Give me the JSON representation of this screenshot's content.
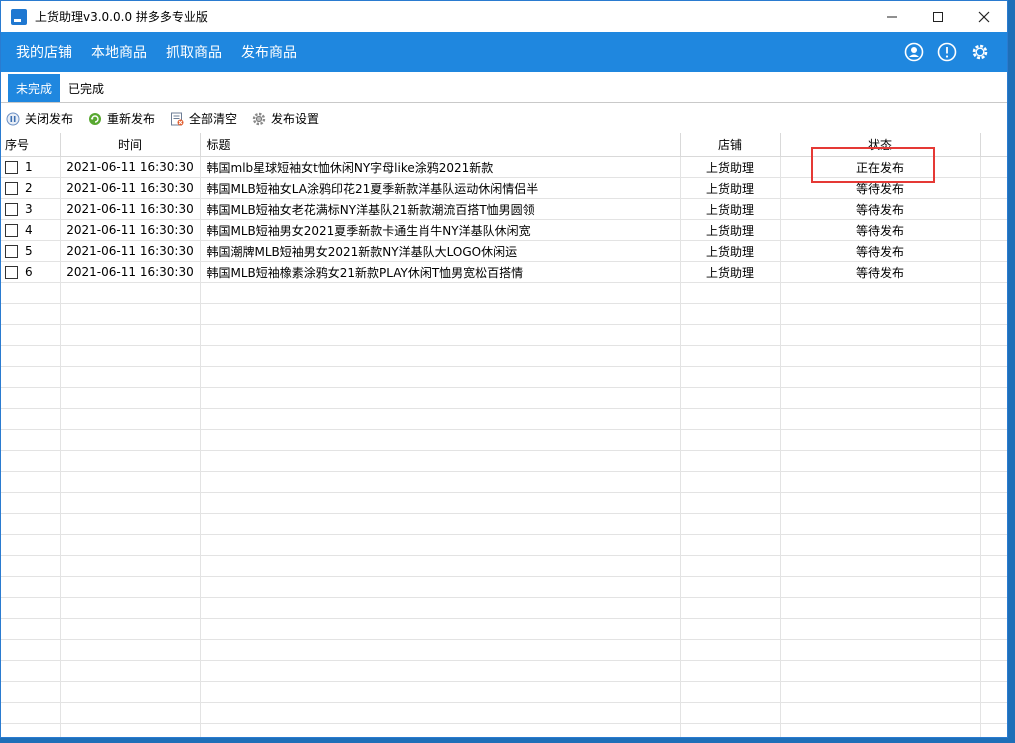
{
  "window": {
    "title": "上货助理v3.0.0.0 拼多多专业版",
    "controls": {
      "minimize": "—",
      "maximize": "☐",
      "close": "✕"
    }
  },
  "menu": {
    "items": [
      "我的店铺",
      "本地商品",
      "抓取商品",
      "发布商品"
    ]
  },
  "tabs": [
    {
      "label": "未完成",
      "active": true
    },
    {
      "label": "已完成",
      "active": false
    }
  ],
  "toolbar": {
    "items": [
      {
        "label": "关闭发布",
        "icon": "pause-icon"
      },
      {
        "label": "重新发布",
        "icon": "refresh-icon"
      },
      {
        "label": "全部清空",
        "icon": "clear-icon"
      },
      {
        "label": "发布设置",
        "icon": "gear-icon"
      }
    ]
  },
  "table": {
    "headers": [
      "序号",
      "时间",
      "标题",
      "店铺",
      "状态"
    ],
    "rows": [
      {
        "seq": "1",
        "time": "2021-06-11 16:30:30",
        "title": "韩国mlb星球短袖女t恤休闲NY字母like涂鸦2021新款",
        "shop": "上货助理",
        "status": "正在发布"
      },
      {
        "seq": "2",
        "time": "2021-06-11 16:30:30",
        "title": "韩国MLB短袖女LA涂鸦印花21夏季新款洋基队运动休闲情侣半",
        "shop": "上货助理",
        "status": "等待发布"
      },
      {
        "seq": "3",
        "time": "2021-06-11 16:30:30",
        "title": "韩国MLB短袖女老花满标NY洋基队21新款潮流百搭T恤男圆领",
        "shop": "上货助理",
        "status": "等待发布"
      },
      {
        "seq": "4",
        "time": "2021-06-11 16:30:30",
        "title": "韩国MLB短袖男女2021夏季新款卡通生肖牛NY洋基队休闲宽",
        "shop": "上货助理",
        "status": "等待发布"
      },
      {
        "seq": "5",
        "time": "2021-06-11 16:30:30",
        "title": "韩国潮牌MLB短袖男女2021新款NY洋基队大LOGO休闲运",
        "shop": "上货助理",
        "status": "等待发布"
      },
      {
        "seq": "6",
        "time": "2021-06-11 16:30:30",
        "title": "韩国MLB短袖橡素涂鸦女21新款PLAY休闲T恤男宽松百搭情",
        "shop": "上货助理",
        "status": "等待发布"
      }
    ]
  },
  "colors": {
    "accent": "#1f87df",
    "highlight": "#e53935"
  }
}
